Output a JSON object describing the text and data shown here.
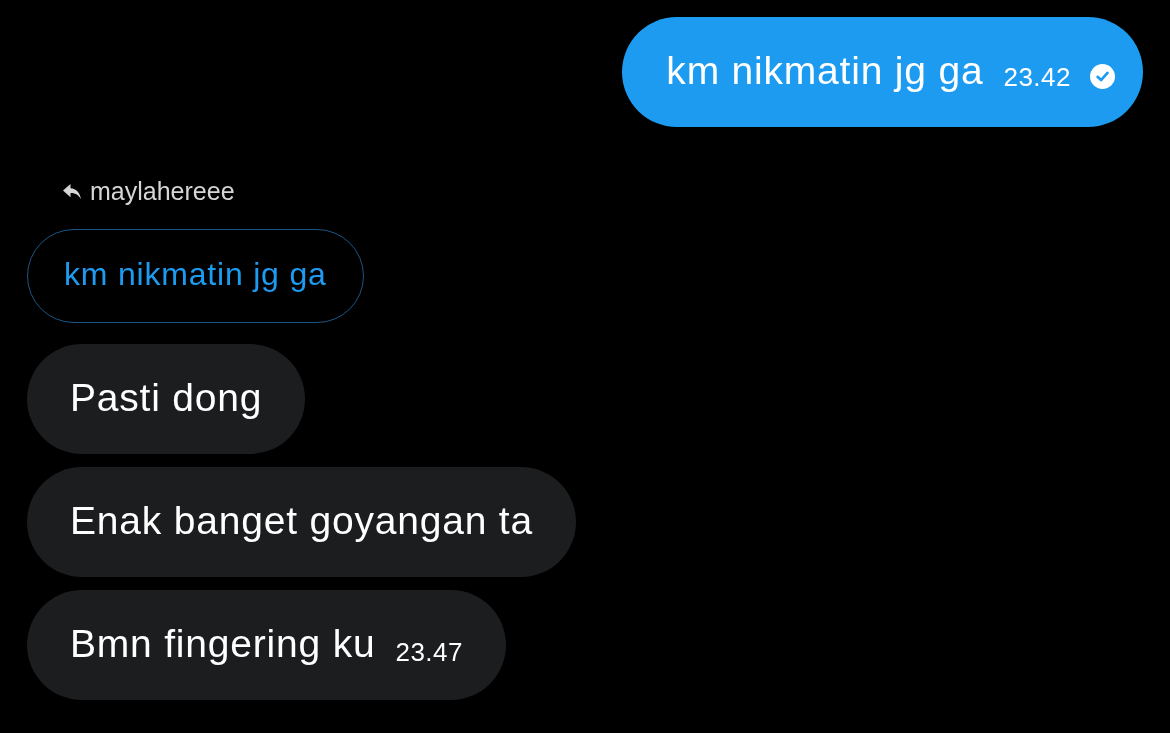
{
  "messages": [
    {
      "kind": "sent",
      "text": "km nikmatin jg ga",
      "time": "23.42",
      "read": true
    },
    {
      "kind": "reply",
      "author": "maylahereee",
      "quote": "km nikmatin jg ga"
    },
    {
      "kind": "received",
      "text": "Pasti dong"
    },
    {
      "kind": "received",
      "text": "Enak banget goyangan ta"
    },
    {
      "kind": "received",
      "text": "Bmn fingering ku",
      "time": "23.47"
    }
  ]
}
